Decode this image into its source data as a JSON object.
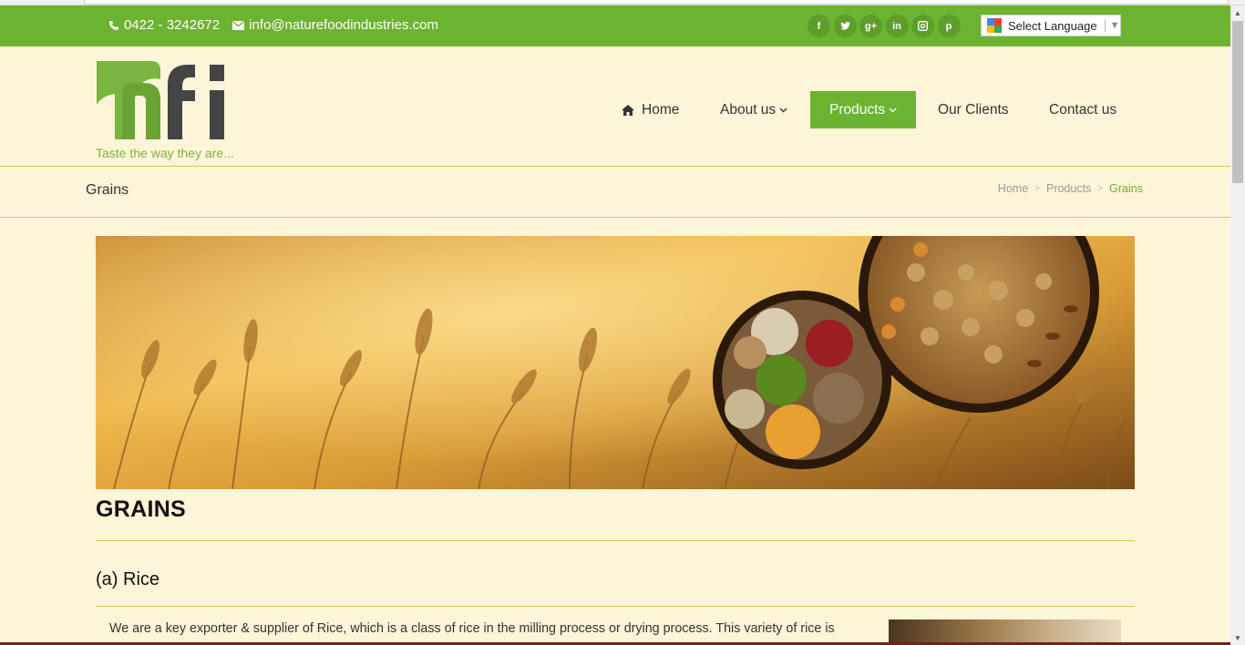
{
  "topbar": {
    "phone": "0422 - 3242672",
    "email": "info@naturefoodindustries.com",
    "social": [
      "f",
      "t",
      "g+",
      "in",
      "ig",
      "p"
    ],
    "language_label": "Select Language",
    "language_arrow": "▼"
  },
  "logo": {
    "tagline": "Taste the way they are..."
  },
  "nav": {
    "items": [
      {
        "label": "Home"
      },
      {
        "label": "About us"
      },
      {
        "label": "Products"
      },
      {
        "label": "Our Clients"
      },
      {
        "label": "Contact us"
      }
    ]
  },
  "breadcrumb": {
    "page_title": "Grains",
    "items": [
      "Home",
      "Products",
      "Grains"
    ]
  },
  "content": {
    "heading": "GRAINS",
    "subheading": "(a) Rice",
    "paragraph": "We are a key exporter & supplier of Rice, which is a class of rice in the milling process or drying process. This variety of rice is"
  },
  "colors": {
    "accent_green": "#6cb331",
    "background": "#fdf5d8",
    "rule": "#e0c454"
  }
}
